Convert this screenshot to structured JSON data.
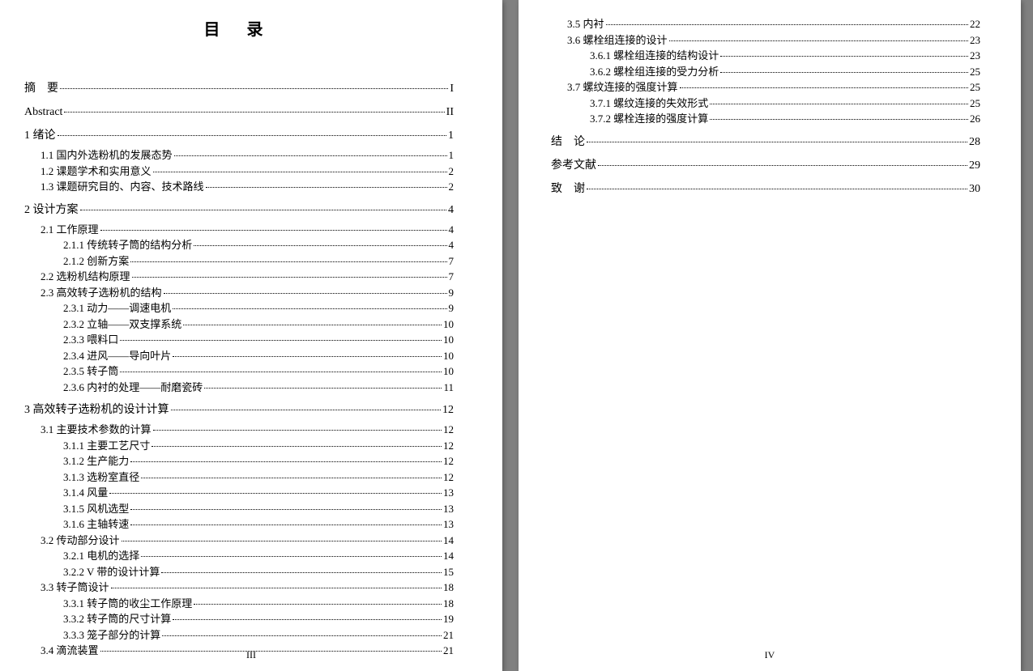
{
  "title": "目 录",
  "pageNumLeft": "III",
  "pageNumRight": "IV",
  "left": [
    {
      "lvl": 0,
      "t": "摘　要",
      "p": "I",
      "cls": ""
    },
    {
      "lvl": 0,
      "t": "Abstract",
      "p": "II",
      "cls": "abstract-en"
    },
    {
      "lvl": 0,
      "t": "1 绪论",
      "p": "1"
    },
    {
      "lvl": 1,
      "t": "1.1 国内外选粉机的发展态势",
      "p": "1"
    },
    {
      "lvl": 1,
      "t": "1.2 课题学术和实用意义",
      "p": "2"
    },
    {
      "lvl": 1,
      "t": "1.3 课题研究目的、内容、技术路线",
      "p": "2"
    },
    {
      "lvl": 0,
      "t": "2 设计方案",
      "p": "4"
    },
    {
      "lvl": 1,
      "t": "2.1 工作原理",
      "p": "4"
    },
    {
      "lvl": 2,
      "t": "2.1.1 传统转子筒的结构分析",
      "p": "4"
    },
    {
      "lvl": 2,
      "t": "2.1.2 创新方案",
      "p": "7"
    },
    {
      "lvl": 1,
      "t": "2.2 选粉机结构原理",
      "p": "7"
    },
    {
      "lvl": 1,
      "t": "2.3 高效转子选粉机的结构",
      "p": "9"
    },
    {
      "lvl": 2,
      "t": "2.3.1 动力——调速电机",
      "p": "9"
    },
    {
      "lvl": 2,
      "t": "2.3.2 立轴——双支撑系统",
      "p": "10"
    },
    {
      "lvl": 2,
      "t": "2.3.3 喂料口",
      "p": "10"
    },
    {
      "lvl": 2,
      "t": "2.3.4 进风——导向叶片",
      "p": "10"
    },
    {
      "lvl": 2,
      "t": "2.3.5 转子筒",
      "p": "10"
    },
    {
      "lvl": 2,
      "t": "2.3.6 内衬的处理——耐磨瓷砖",
      "p": "11"
    },
    {
      "lvl": 0,
      "t": "3  高效转子选粉机的设计计算",
      "p": "12"
    },
    {
      "lvl": 1,
      "t": "3.1 主要技术参数的计算",
      "p": "12"
    },
    {
      "lvl": 2,
      "t": "3.1.1 主要工艺尺寸",
      "p": "12"
    },
    {
      "lvl": 2,
      "t": "3.1.2 生产能力",
      "p": "12"
    },
    {
      "lvl": 2,
      "t": "3.1.3 选粉室直径",
      "p": "12"
    },
    {
      "lvl": 2,
      "t": "3.1.4 风量",
      "p": "13"
    },
    {
      "lvl": 2,
      "t": "3.1.5 风机选型",
      "p": "13"
    },
    {
      "lvl": 2,
      "t": "3.1.6 主轴转速",
      "p": "13"
    },
    {
      "lvl": 1,
      "t": "3.2 传动部分设计",
      "p": "14"
    },
    {
      "lvl": 2,
      "t": "3.2.1 电机的选择",
      "p": "14"
    },
    {
      "lvl": 2,
      "t": "3.2.2 V 带的设计计算",
      "p": "15"
    },
    {
      "lvl": 1,
      "t": "3.3 转子筒设计",
      "p": "18"
    },
    {
      "lvl": 2,
      "t": "3.3.1 转子筒的收尘工作原理",
      "p": "18"
    },
    {
      "lvl": 2,
      "t": "3.3.2 转子筒的尺寸计算",
      "p": "19"
    },
    {
      "lvl": 2,
      "t": "3.3.3 笼子部分的计算",
      "p": "21"
    },
    {
      "lvl": 1,
      "t": "3.4 滴流装置",
      "p": "21"
    }
  ],
  "right": [
    {
      "lvl": 1,
      "t": "3.5 内衬",
      "p": "22"
    },
    {
      "lvl": 1,
      "t": "3.6 螺栓组连接的设计",
      "p": "23"
    },
    {
      "lvl": 2,
      "t": "3.6.1 螺栓组连接的结构设计",
      "p": "23"
    },
    {
      "lvl": 2,
      "t": "3.6.2 螺栓组连接的受力分析",
      "p": "25"
    },
    {
      "lvl": 1,
      "t": "3.7 螺纹连接的强度计算",
      "p": "25"
    },
    {
      "lvl": 2,
      "t": "3.7.1 螺纹连接的失效形式",
      "p": "25"
    },
    {
      "lvl": 2,
      "t": "3.7.2 螺栓连接的强度计算",
      "p": "26"
    },
    {
      "lvl": 0,
      "t": "结　论",
      "p": "28"
    },
    {
      "lvl": 0,
      "t": "参考文献",
      "p": "29"
    },
    {
      "lvl": 0,
      "t": "致　谢",
      "p": "30"
    }
  ]
}
